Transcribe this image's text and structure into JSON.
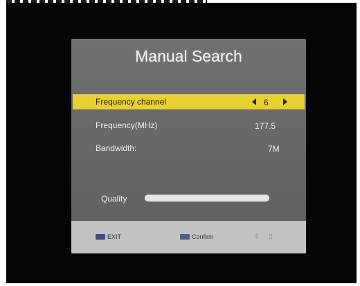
{
  "dialog": {
    "title": "Manual Search",
    "rows": [
      {
        "label": "Frequency channel",
        "value": "6",
        "selected": true
      },
      {
        "label": "Frequency(MHz)",
        "value": "177.5",
        "selected": false
      },
      {
        "label": "Bandwidth:",
        "value": "7M",
        "selected": false
      }
    ],
    "quality": {
      "label": "Quality",
      "level_fraction": 1.0
    }
  },
  "footer": {
    "exit_label": "EXIT",
    "confirm_label": "Confirm",
    "exit_icon": "exit-key-icon",
    "confirm_icon": "ok-key-icon"
  },
  "colors": {
    "highlight": "#e8cf33",
    "panel": "#6a6a6a",
    "footer": "#c2c2c2"
  }
}
